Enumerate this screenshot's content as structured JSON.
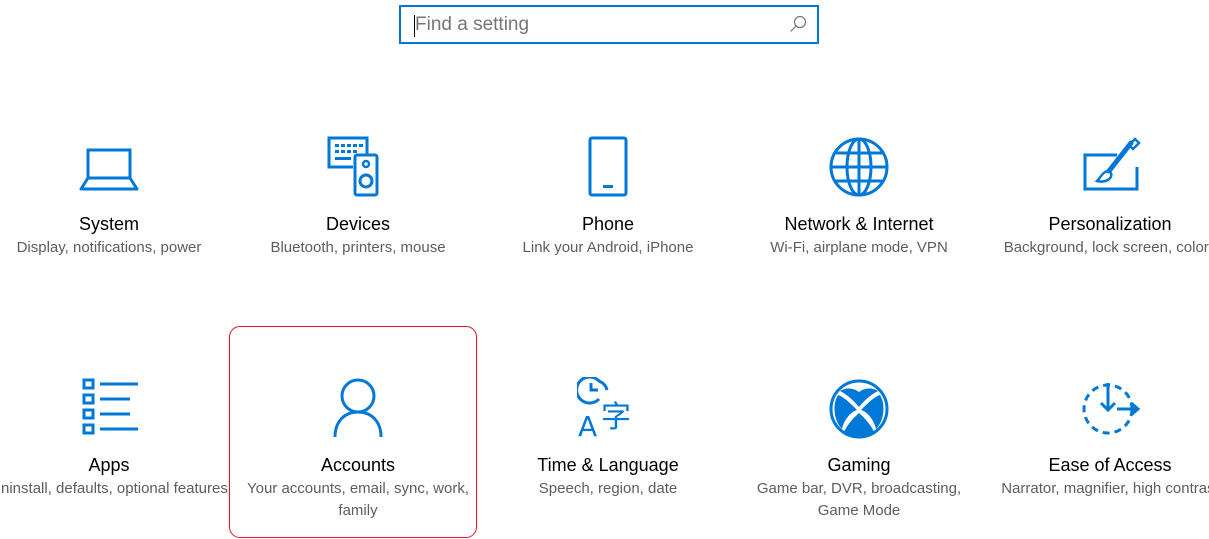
{
  "search": {
    "placeholder": "Find a setting",
    "value": "",
    "icon": "search-icon"
  },
  "accent_color": "#0078d7",
  "highlight_color": "#e81123",
  "categories": [
    {
      "id": "system",
      "name": "System",
      "description": "Display, notifications, power",
      "icon": "laptop-icon"
    },
    {
      "id": "devices",
      "name": "Devices",
      "description": "Bluetooth, printers, mouse",
      "icon": "keyboard-speaker-icon"
    },
    {
      "id": "phone",
      "name": "Phone",
      "description": "Link your Android, iPhone",
      "icon": "phone-icon"
    },
    {
      "id": "network",
      "name": "Network & Internet",
      "description": "Wi-Fi, airplane mode, VPN",
      "icon": "globe-icon"
    },
    {
      "id": "personalization",
      "name": "Personalization",
      "description": "Background, lock screen, colors",
      "icon": "paintbrush-monitor-icon"
    },
    {
      "id": "apps",
      "name": "Apps",
      "description": "Uninstall, defaults, optional features",
      "icon": "apps-list-icon"
    },
    {
      "id": "accounts",
      "name": "Accounts",
      "description": "Your accounts, email, sync, work, family",
      "icon": "person-icon",
      "highlighted": true
    },
    {
      "id": "time-language",
      "name": "Time & Language",
      "description": "Speech, region, date",
      "icon": "clock-language-icon"
    },
    {
      "id": "gaming",
      "name": "Gaming",
      "description": "Game bar, DVR, broadcasting, Game Mode",
      "icon": "xbox-icon"
    },
    {
      "id": "ease-of-access",
      "name": "Ease of Access",
      "description": "Narrator, magnifier, high contrast",
      "icon": "ease-of-access-icon"
    }
  ]
}
